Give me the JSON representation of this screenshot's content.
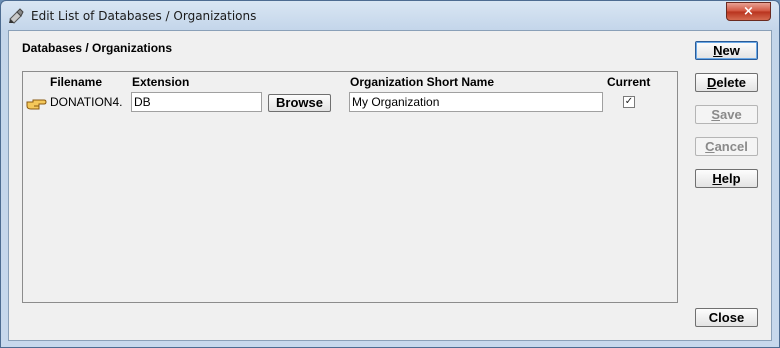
{
  "window": {
    "title": "Edit List of Databases / Organizations",
    "close_glyph": "×"
  },
  "group": {
    "label": "Databases / Organizations"
  },
  "columns": {
    "filename": "Filename",
    "extension": "Extension",
    "org_name": "Organization Short Name",
    "current": "Current"
  },
  "row": {
    "filename": "DONATION4.",
    "extension": "DB",
    "browse": "Browse",
    "org_name": "My Organization",
    "current_checked": true,
    "check_glyph": "✓"
  },
  "buttons": {
    "new": {
      "mnemonic": "N",
      "rest": "ew"
    },
    "delete": {
      "mnemonic": "D",
      "rest": "elete"
    },
    "save": {
      "mnemonic": "S",
      "rest": "ave"
    },
    "cancel": {
      "mnemonic": "C",
      "rest": "ancel"
    },
    "help": {
      "mnemonic": "H",
      "rest": "elp"
    },
    "close": "Close"
  },
  "icons": {
    "app": "database-pen-icon",
    "row_pointer": "pointing-hand-icon"
  }
}
